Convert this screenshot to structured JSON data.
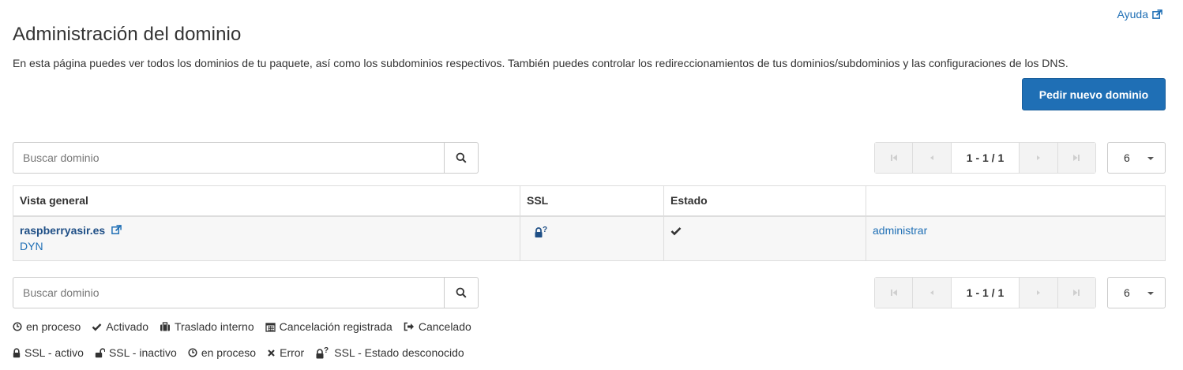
{
  "header": {
    "help_label": "Ayuda",
    "title": "Administración del dominio",
    "description": "En esta página puedes ver todos los dominios de tu paquete, así como los subdominios respectivos. También puedes controlar los redireccionamientos de tus dominios/subdominios y las configuraciones de los DNS.",
    "order_button_label": "Pedir nuevo dominio"
  },
  "search": {
    "placeholder": "Buscar dominio"
  },
  "pagination": {
    "info": "1 - 1 / 1",
    "per_page": "6"
  },
  "table": {
    "columns": [
      "Vista general",
      "SSL",
      "Estado",
      ""
    ],
    "rows": [
      {
        "domain": "raspberryasir.es",
        "type": "DYN",
        "action": "administrar"
      }
    ]
  },
  "legend_status": [
    {
      "icon": "clock-icon",
      "label": "en proceso"
    },
    {
      "icon": "check-icon",
      "label": "Activado"
    },
    {
      "icon": "briefcase-icon",
      "label": "Traslado interno"
    },
    {
      "icon": "calendar-icon",
      "label": "Cancelación registrada"
    },
    {
      "icon": "sign-out-icon",
      "label": "Cancelado"
    }
  ],
  "legend_ssl": [
    {
      "icon": "lock-icon",
      "label": "SSL - activo"
    },
    {
      "icon": "unlock-icon",
      "label": "SSL - inactivo"
    },
    {
      "icon": "clock-icon",
      "label": "en proceso"
    },
    {
      "icon": "times-icon",
      "label": "Error"
    },
    {
      "icon": "lock-question-icon",
      "label": "SSL - Estado desconocido"
    }
  ],
  "colors": {
    "accent": "#1f6fb5",
    "link_dark": "#1f4f86",
    "border": "#dddddd"
  }
}
